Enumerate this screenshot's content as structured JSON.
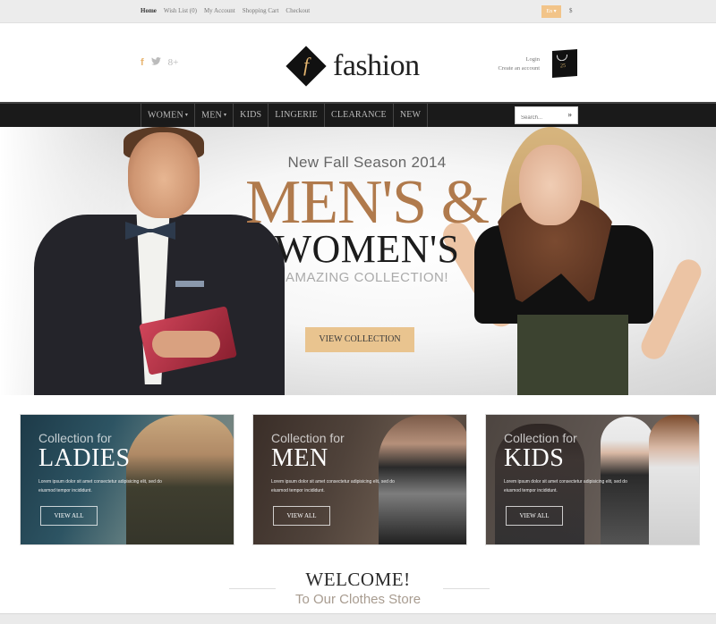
{
  "topbar": {
    "links": [
      "Home",
      "Wish List (0)",
      "My Account",
      "Shopping Cart",
      "Checkout"
    ],
    "active_link": "Home",
    "language": "En",
    "currency": "$"
  },
  "header": {
    "social": {
      "facebook": "f",
      "twitter": "🐦",
      "google_plus": "8+"
    },
    "logo_mark": "f",
    "logo_text": "fashion",
    "login_label": "Login",
    "create_account_label": "Create an account",
    "cart_badge": "25"
  },
  "nav": {
    "items": [
      {
        "label": "WOMEN",
        "dropdown": true,
        "active": true
      },
      {
        "label": "MEN",
        "dropdown": true,
        "active": false
      },
      {
        "label": "KIDS",
        "dropdown": false,
        "active": false
      },
      {
        "label": "LINGERIE",
        "dropdown": false,
        "active": false
      },
      {
        "label": "CLEARANCE",
        "dropdown": false,
        "active": false
      },
      {
        "label": "NEW",
        "dropdown": false,
        "active": false
      }
    ],
    "caret": "▾",
    "search_placeholder": "Search...",
    "search_go": "»"
  },
  "hero": {
    "season": "New Fall Season 2014",
    "headline_1": "MEN'S &",
    "headline_2": "WOMEN'S",
    "tagline": "AMAZING COLLECTION!",
    "cta": "VIEW COLLECTION",
    "accent_color": "#b07a4c",
    "cta_color": "#e9c48f"
  },
  "cards": [
    {
      "sub": "Collection for",
      "title": "LADIES",
      "desc": "Lorem ipsum dolor sit amet consectetur adipisicing elit, sed do eiusmod tempor incididunt.",
      "button": "VIEW ALL"
    },
    {
      "sub": "Collection for",
      "title": "MEN",
      "desc": "Lorem ipsum dolor sit amet consectetur adipisicing elit, sed do eiusmod tempor incididunt.",
      "button": "VIEW ALL"
    },
    {
      "sub": "Collection for",
      "title": "KIDS",
      "desc": "Lorem ipsum dolor sit amet consectetur adipisicing elit, sed do eiusmod tempor incididunt.",
      "button": "VIEW ALL"
    }
  ],
  "welcome": {
    "title": "WELCOME!",
    "subtitle": "To Our Clothes Store"
  }
}
